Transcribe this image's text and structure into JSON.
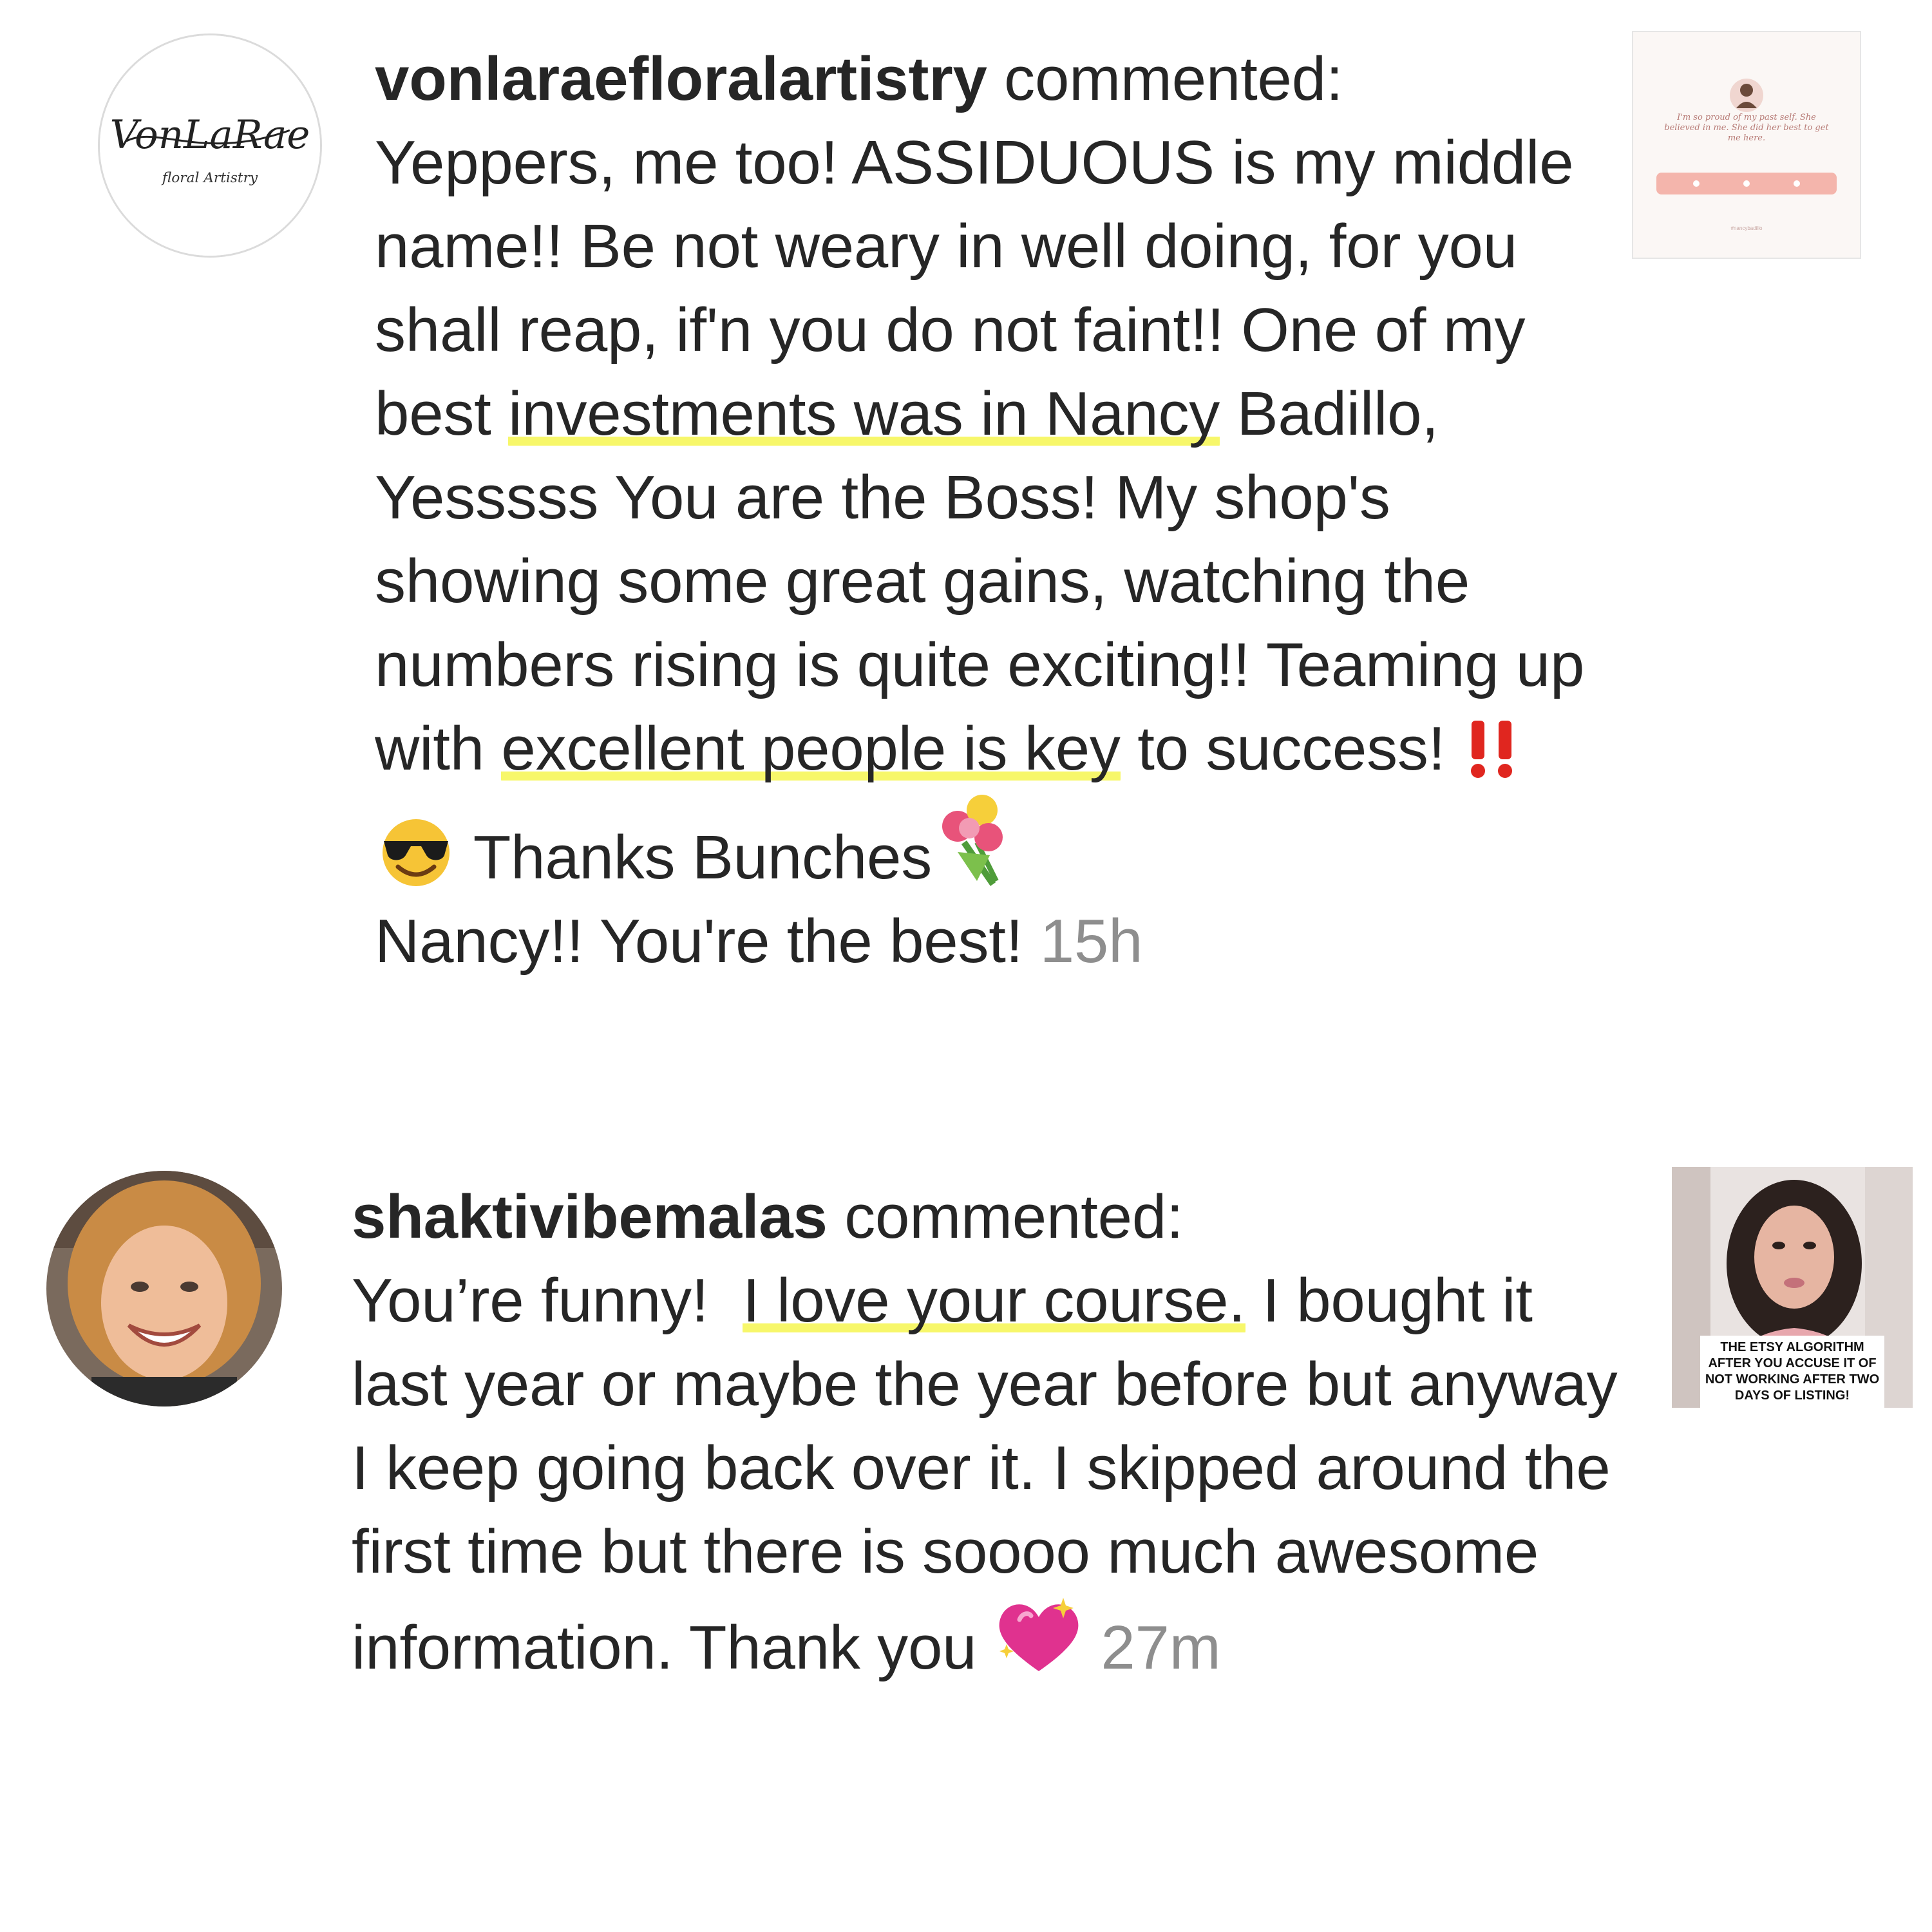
{
  "comments": [
    {
      "avatar": {
        "icon": "vonlarae-logo-icon",
        "logo_text_main": "VonLaRae",
        "logo_text_sub": "floral Artistry"
      },
      "username": "vonlaraefloralartistry",
      "action": "commented:",
      "segments": {
        "s1": "Yeppers, me too! ASSIDUOUS is my middle name!! Be not weary in well doing, for you shall reap, if'n you do not faint!! One of my best ",
        "h1": "investments was in Nancy",
        "s2": " Badillo, Yesssss You are the Boss! My shop's showing some great gains, watching the numbers rising is quite exciting!! Teaming up with ",
        "h2": "excellent people is key",
        "s3": " to success! ",
        "s4": " Thanks Bunches",
        "s5": "Nancy!! You're the best!"
      },
      "emojis": [
        "double-exclamation-icon",
        "sunglasses-smiley-icon",
        "bouquet-icon"
      ],
      "timestamp": "15h",
      "thumbnail": {
        "icon": "post-thumbnail-icon",
        "caption": "I'm so proud of my past self. She believed in me. She did her best to get me here.",
        "tag": "#nancybadillo"
      }
    },
    {
      "avatar": {
        "icon": "user-photo-icon"
      },
      "username": "shaktivibemalas",
      "action": "commented:",
      "segments": {
        "s1": "You’re funny!  ",
        "h1": "I love your course.",
        "s2": " I bought it last year or maybe the year before but anyway I keep going back over it. I skipped around the first time but there is soooo much awesome information. Thank you "
      },
      "emojis": [
        "sparkling-heart-icon"
      ],
      "timestamp": "27m",
      "thumbnail": {
        "icon": "video-thumbnail-icon",
        "caption": "THE ETSY ALGORITHM AFTER YOU ACCUSE IT OF NOT WORKING AFTER TWO DAYS OF LISTING!"
      }
    }
  ],
  "colors": {
    "text": "#262626",
    "timestamp": "#8e8e8e",
    "highlight": "#f7f76a",
    "exclamation": "#e0261f"
  }
}
